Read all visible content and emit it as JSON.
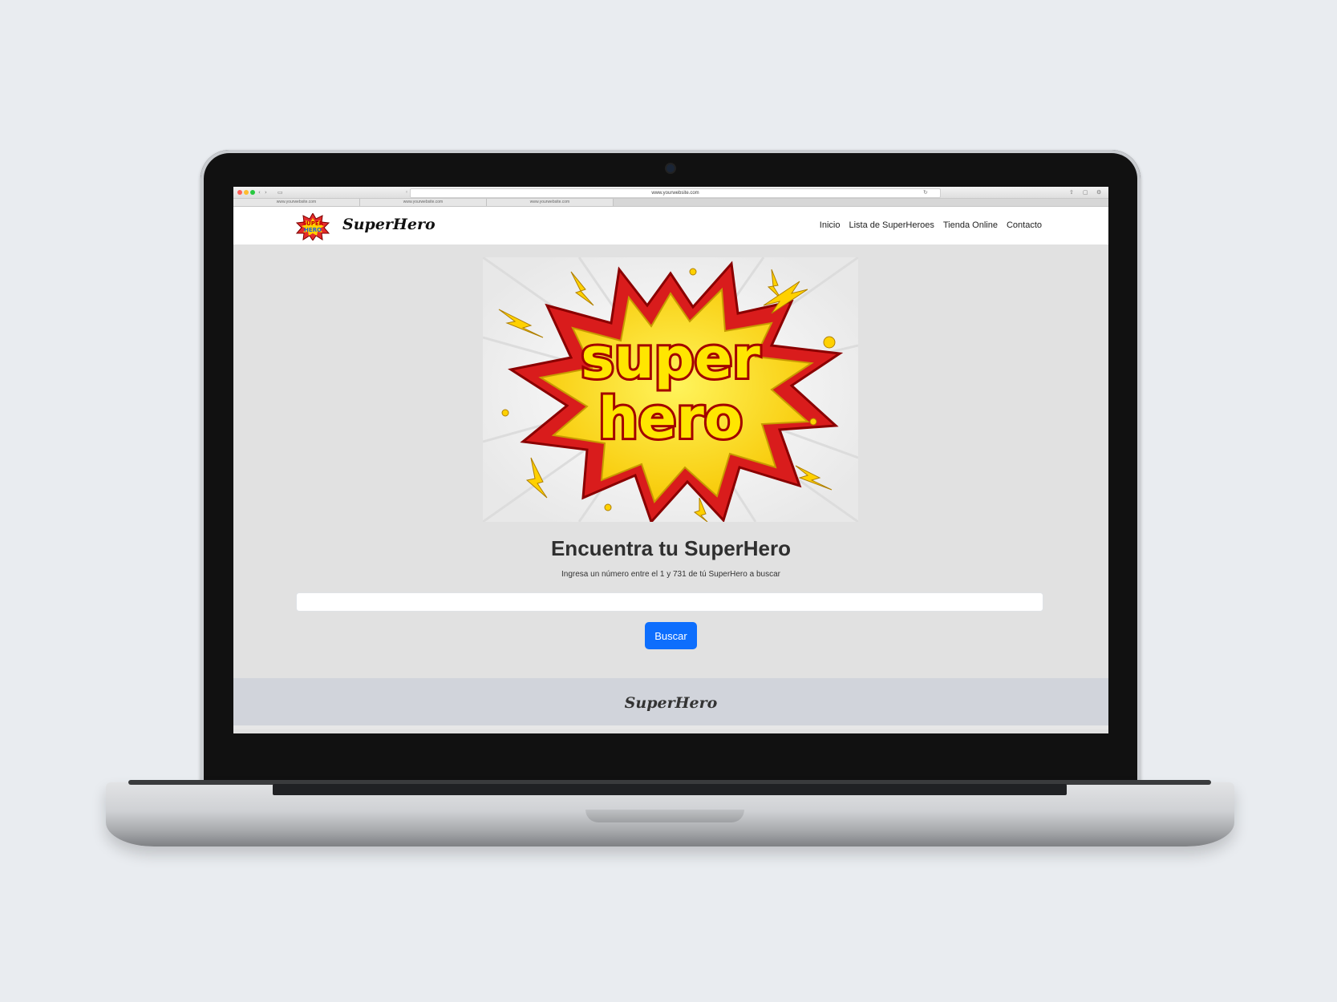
{
  "browser": {
    "url": "www.yourwebsite.com",
    "tabs": [
      "www.yourwebsite.com",
      "www.yourwebsite.com",
      "www.yourwebsite.com"
    ]
  },
  "site": {
    "brand": "SuperHero",
    "logo_text": "SUPER HERO",
    "nav": {
      "items": [
        "Inicio",
        "Lista de SuperHeroes",
        "Tienda Online",
        "Contacto"
      ]
    },
    "hero_image_text": {
      "line1": "super",
      "line2": "hero"
    },
    "heading": "Encuentra tu SuperHero",
    "subtext": "Ingresa un número entre el 1 y 731 de tú SuperHero a buscar",
    "search": {
      "value": "",
      "button_label": "Buscar"
    },
    "footer_brand": "SuperHero"
  },
  "colors": {
    "primary_button": "#0d6efd",
    "content_background": "#e1e1e1",
    "footer_background": "#d1d4db"
  }
}
